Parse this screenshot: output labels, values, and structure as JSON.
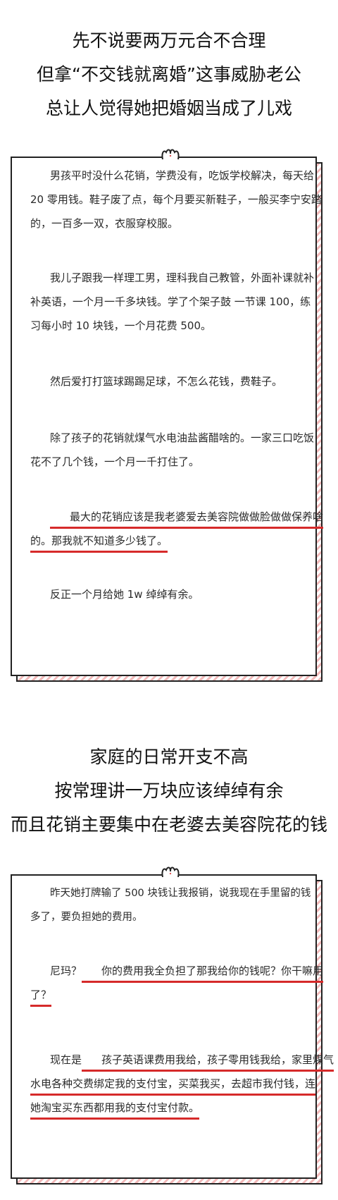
{
  "heading1": [
    "先不说要两万元合不合理",
    "但拿“不交钱就离婚”这事威胁老公",
    "总让人觉得她把婚姻当成了儿戏"
  ],
  "card1": {
    "p1": [
      "男孩平时没什么花销，学费没有，吃饭学校解决，每天给",
      "20 零用钱。鞋子废了点，每个月要买新鞋子，一般买李宁安踏",
      "的，一百多一双，衣服穿校服。"
    ],
    "p2": [
      "我儿子跟我一样理工男，理科我自己教管，外面补课就补",
      "补英语，一个月一千多块钱。学了个架子鼓 一节课 100，练",
      "习每小时 10 块钱，一个月花费 500。"
    ],
    "p3": [
      "然后爱打打篮球踢踢足球，不怎么花钱，费鞋子。"
    ],
    "p4": [
      "除了孩子的花销就煤气水电油盐酱醋啥的。一家三口吃饭",
      "花不了几个钱，一个月一千打住了。"
    ],
    "p5": [
      "最大的花销应该是我老婆爱去美容院做做脸做做保养啥",
      "的。那我就不知道多少钱了。"
    ],
    "p6": [
      "反正一个月给她 1w 绰绰有余。"
    ]
  },
  "heading2": [
    "家庭的日常开支不高",
    "按常理讲一万块应该绰绰有余",
    "而且花销主要集中在老婆去美容院花的钱"
  ],
  "card2": {
    "p1": [
      "昨天她打牌输了 500 块钱让我报销，说我现在手里留的钱",
      "多了，要负担她的费用。"
    ],
    "p2_prefix": "尼玛？",
    "p2_line1": "你的费用我全负担了那我给你的钱呢？你干嘛用",
    "p2_line2": "了？",
    "p3_prefix": "现在是",
    "p3_line1": "孩子英语课费用我给，孩子零用钱我给，家里煤气",
    "p3_line2": "水电各种交费绑定我的支付宝，买菜我买，去超市我付钱，连",
    "p3_line3": "她淘宝买东西都用我的支付宝付款。"
  },
  "colors": {
    "underline": "#d62a2a",
    "stripe": "#f2b9b9",
    "border": "#222222"
  }
}
